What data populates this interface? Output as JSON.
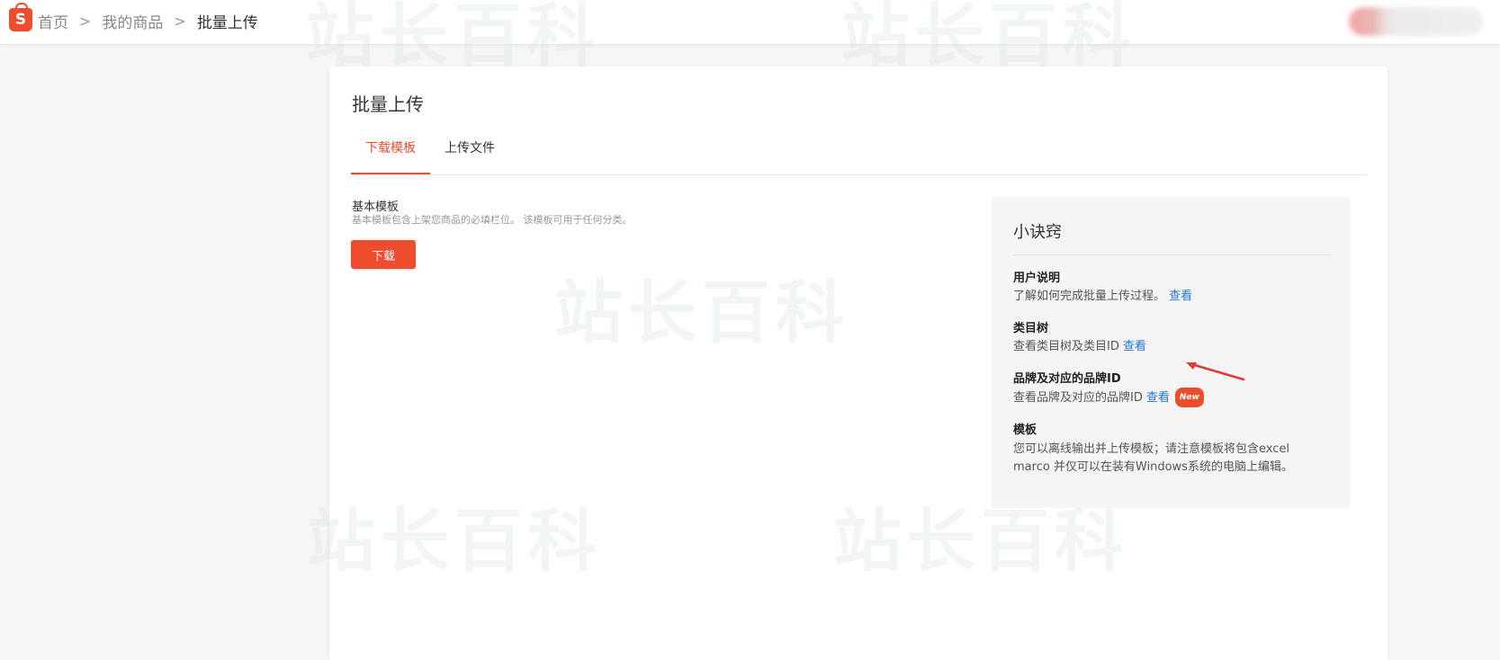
{
  "header": {
    "logo_letter": "S",
    "breadcrumb": [
      "首页",
      "我的商品",
      "批量上传"
    ],
    "separator": ">"
  },
  "watermark_text": "站长百科",
  "page": {
    "title": "批量上传",
    "tabs": [
      {
        "label": "下载模板",
        "active": true
      },
      {
        "label": "上传文件",
        "active": false
      }
    ],
    "section": {
      "title": "基本模板",
      "description": "基本模板包含上架您商品的必填栏位。 该模板可用于任何分类。",
      "button_label": "下载"
    }
  },
  "tips": {
    "title": "小诀窍",
    "items": [
      {
        "heading": "用户说明",
        "text": "了解如何完成批量上传过程。",
        "link": "查看"
      },
      {
        "heading": "类目树",
        "text": "查看类目树及类目ID",
        "link": "查看"
      },
      {
        "heading": "品牌及对应的品牌ID",
        "text": "查看品牌及对应的品牌ID",
        "link": "查看",
        "badge": "New"
      },
      {
        "heading": "模板",
        "text": "您可以离线输出并上传模板；请注意模板将包含excel marco 并仅可以在装有Windows系统的电脑上编辑。"
      }
    ]
  },
  "colors": {
    "accent": "#ee4d2d",
    "link": "#2673dd",
    "arrow": "#e03a3a"
  }
}
